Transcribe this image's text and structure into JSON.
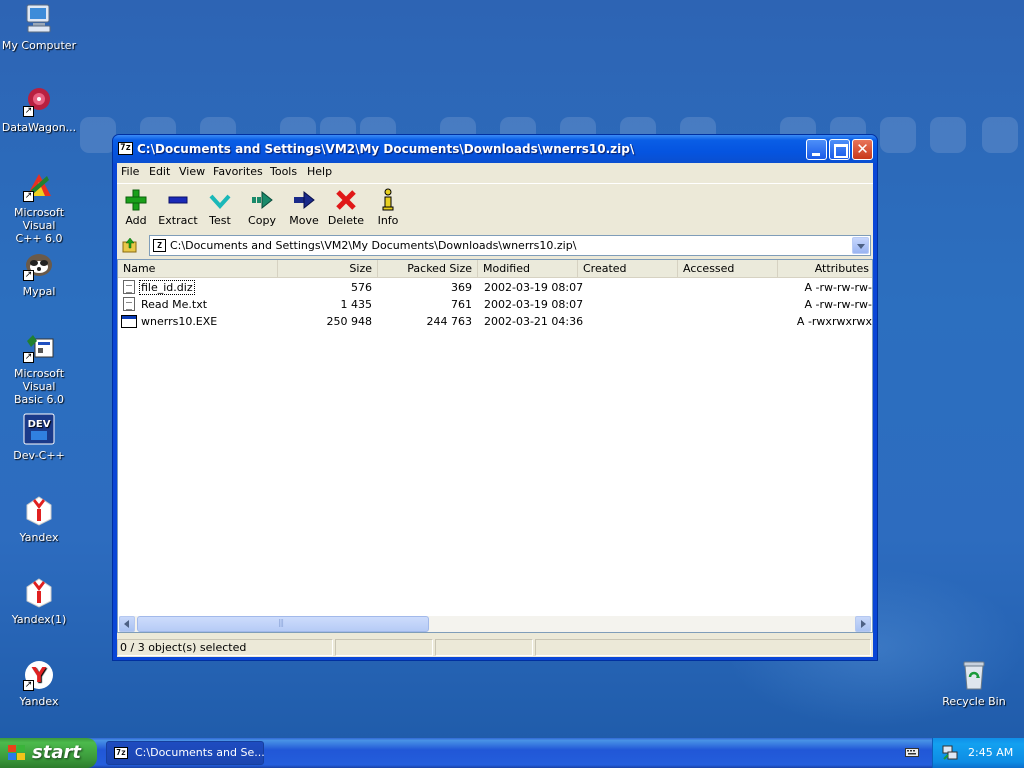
{
  "desktop": {
    "icons": [
      {
        "label_lines": [
          "My Computer"
        ],
        "icon": "my-computer-icon"
      },
      {
        "label_lines": [
          "DataWagon..."
        ],
        "icon": "datawagon-icon"
      },
      {
        "label_lines": [
          "Microsoft Visual",
          "C++ 6.0"
        ],
        "icon": "visual-cpp-icon"
      },
      {
        "label_lines": [
          "Mypal"
        ],
        "icon": "mypal-icon"
      },
      {
        "label_lines": [
          "Microsoft Visual",
          "Basic 6.0"
        ],
        "icon": "visual-basic-icon"
      },
      {
        "label_lines": [
          "Dev-C++"
        ],
        "icon": "devcpp-icon"
      },
      {
        "label_lines": [
          "Yandex"
        ],
        "icon": "yandex-icon"
      },
      {
        "label_lines": [
          "Yandex(1)"
        ],
        "icon": "yandex-icon"
      },
      {
        "label_lines": [
          "Yandex"
        ],
        "icon": "yandex-browser-icon"
      }
    ],
    "recycle_bin": {
      "label": "Recycle Bin",
      "icon": "recycle-bin-icon"
    }
  },
  "window": {
    "app_icon_text": "7z",
    "title": "C:\\Documents and Settings\\VM2\\My Documents\\Downloads\\wnerrs10.zip\\",
    "menu": [
      "File",
      "Edit",
      "View",
      "Favorites",
      "Tools",
      "Help"
    ],
    "toolbar": [
      {
        "label": "Add",
        "icon": "add-icon",
        "color": "#1aa01a"
      },
      {
        "label": "Extract",
        "icon": "extract-icon",
        "color": "#1a2ab8"
      },
      {
        "label": "Test",
        "icon": "test-icon",
        "color": "#1ab8b8"
      },
      {
        "label": "Copy",
        "icon": "copy-icon",
        "color": "#1a8a6a"
      },
      {
        "label": "Move",
        "icon": "move-icon",
        "color": "#1a2a8a"
      },
      {
        "label": "Delete",
        "icon": "delete-icon",
        "color": "#e01818"
      },
      {
        "label": "Info",
        "icon": "info-icon",
        "color": "#e8d020"
      }
    ],
    "address": "C:\\Documents and Settings\\VM2\\My Documents\\Downloads\\wnerrs10.zip\\",
    "columns": [
      "Name",
      "Size",
      "Packed Size",
      "Modified",
      "Created",
      "Accessed",
      "Attributes"
    ],
    "files": [
      {
        "name": "file_id.diz",
        "size": "576",
        "packed": "369",
        "modified": "2002-03-19 08:07",
        "created": "",
        "accessed": "",
        "attributes": "A -rw-rw-rw-",
        "type": "text"
      },
      {
        "name": "Read Me.txt",
        "size": "1 435",
        "packed": "761",
        "modified": "2002-03-19 08:07",
        "created": "",
        "accessed": "",
        "attributes": "A -rw-rw-rw-",
        "type": "text"
      },
      {
        "name": "wnerrs10.EXE",
        "size": "250 948",
        "packed": "244 763",
        "modified": "2002-03-21 04:36",
        "created": "",
        "accessed": "",
        "attributes": "A -rwxrwxrwx",
        "type": "exe"
      }
    ],
    "status": "0 / 3 object(s) selected"
  },
  "taskbar": {
    "start_label": "start",
    "task_label": "C:\\Documents and Se...",
    "clock": "2:45 AM"
  },
  "colors": {
    "desktop": "#2c6fbf",
    "title_bar": "#0554e0",
    "start_button": "#3a983a",
    "tray": "#0d8ce4"
  }
}
